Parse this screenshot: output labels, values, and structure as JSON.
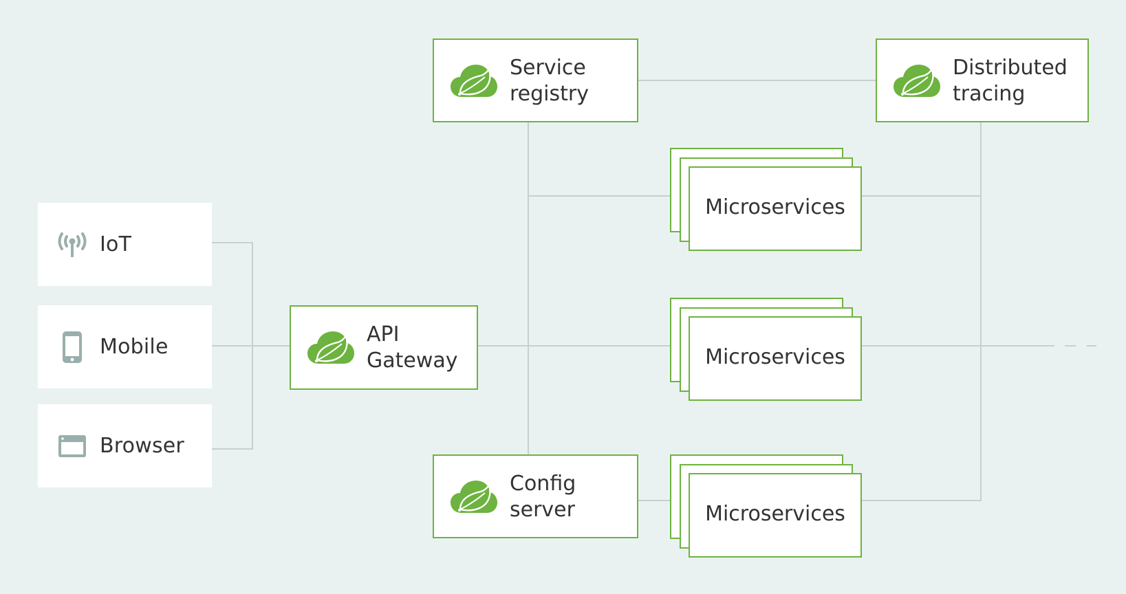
{
  "colors": {
    "background": "#EAF2F1",
    "accent_green": "#6DB33F",
    "connector": "#C7D0CF",
    "icon_gray": "#9AAFAC",
    "text": "#333333"
  },
  "clients": [
    {
      "label": "IoT",
      "icon": "antenna-icon"
    },
    {
      "label": "Mobile",
      "icon": "mobile-phone-icon"
    },
    {
      "label": "Browser",
      "icon": "browser-window-icon"
    }
  ],
  "gateway": {
    "line1": "API",
    "line2": "Gateway",
    "icon": "spring-cloud-icon"
  },
  "service_registry": {
    "line1": "Service",
    "line2": "registry",
    "icon": "spring-cloud-icon"
  },
  "config_server": {
    "line1": "Config",
    "line2": "server",
    "icon": "spring-cloud-icon"
  },
  "distributed_tracing": {
    "line1": "Distributed",
    "line2": "tracing",
    "icon": "spring-cloud-icon"
  },
  "microservices": [
    {
      "label": "Microservices"
    },
    {
      "label": "Microservices"
    },
    {
      "label": "Microservices"
    }
  ]
}
